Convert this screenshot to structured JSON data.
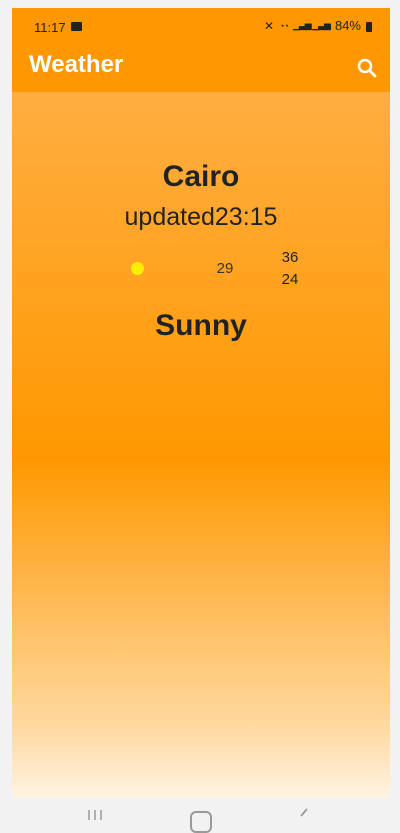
{
  "status_bar": {
    "time": "11:17",
    "battery": "84%",
    "icons": [
      "gallery-icon",
      "mute-icon",
      "wifi-icon",
      "signal-icon",
      "battery-icon"
    ]
  },
  "app_bar": {
    "title": "Weather",
    "search_icon": "search-icon",
    "background": "#ff9800"
  },
  "weather": {
    "city": "Cairo",
    "updated": "updated23:15",
    "icon": "sun-icon",
    "temp_current": "29",
    "temp_max": "36",
    "temp_min": "24",
    "condition": "Sunny"
  },
  "colors": {
    "accent": "#ff9800",
    "sun": "#ffee00",
    "text": "#222222"
  }
}
